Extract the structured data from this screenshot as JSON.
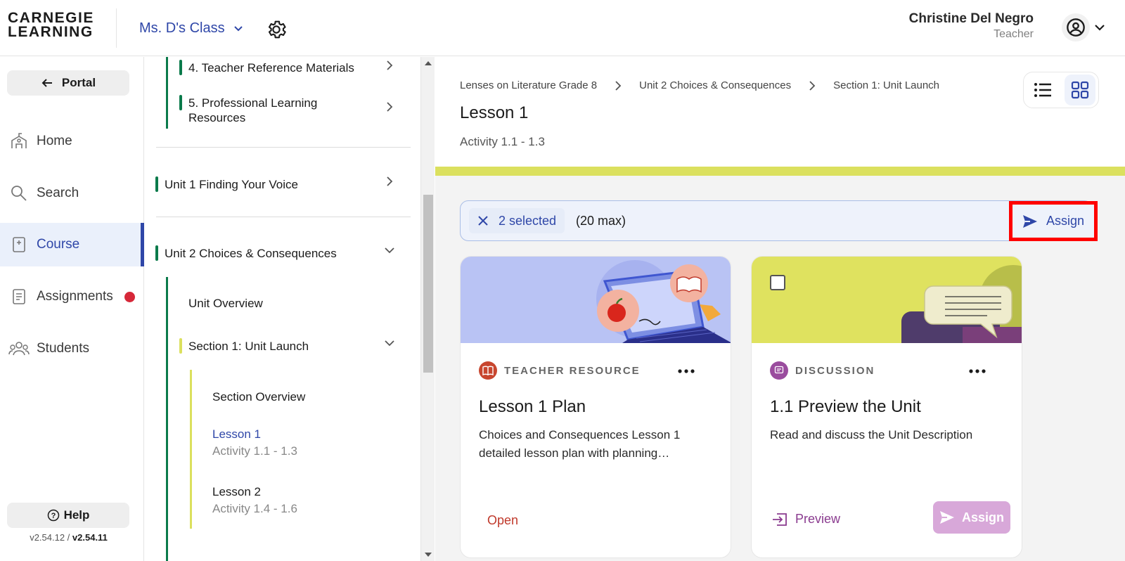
{
  "header": {
    "logo_line1": "CARNEGIE",
    "logo_line2": "LEARNING",
    "class_name": "Ms. D's Class",
    "user_name": "Christine Del Negro",
    "user_role": "Teacher"
  },
  "leftnav": {
    "portal_label": "Portal",
    "items": [
      {
        "label": "Home",
        "icon": "school-icon"
      },
      {
        "label": "Search",
        "icon": "search-icon"
      },
      {
        "label": "Course",
        "icon": "course-book-icon"
      },
      {
        "label": "Assignments",
        "icon": "assignments-icon"
      },
      {
        "label": "Students",
        "icon": "students-icon"
      }
    ],
    "help_label": "Help",
    "version_current": "v2.54.12",
    "version_sep": " / ",
    "version_latest": "v2.54.11"
  },
  "tree": {
    "teacher_ref": "4. Teacher Reference Materials",
    "prof_learning": "5. Professional Learning Resources",
    "unit1": "Unit 1 Finding Your Voice",
    "unit2": "Unit 2 Choices & Consequences",
    "unit_overview": "Unit Overview",
    "section1": "Section 1: Unit Launch",
    "section_overview": "Section Overview",
    "lesson1_title": "Lesson 1",
    "lesson1_sub": "Activity 1.1 - 1.3",
    "lesson2_title": "Lesson 2",
    "lesson2_sub": "Activity 1.4 - 1.6"
  },
  "main": {
    "breadcrumbs": [
      "Lenses on Literature Grade 8",
      "Unit 2 Choices & Consequences",
      "Section 1: Unit Launch"
    ],
    "title": "Lesson 1",
    "subtitle": "Activity 1.1 - 1.3",
    "selection": {
      "selected_text": "2 selected",
      "max_text": "(20 max)",
      "assign_label": "Assign"
    },
    "cards": [
      {
        "type": "TEACHER RESOURCE",
        "title": "Lesson 1 Plan",
        "description": "Choices and Consequences Lesson 1 detailed lesson plan with planning…",
        "action": "Open"
      },
      {
        "type": "DISCUSSION",
        "title": "1.1 Preview the Unit",
        "description": "Read and discuss the Unit Description",
        "preview_label": "Preview",
        "assign_label": "Assign"
      }
    ]
  },
  "colors": {
    "primary": "#2f47a8",
    "unit_green": "#0b7a4b",
    "section_yellow": "#dbe05e",
    "alert_red": "#d62839",
    "highlight": "#ff0000"
  }
}
